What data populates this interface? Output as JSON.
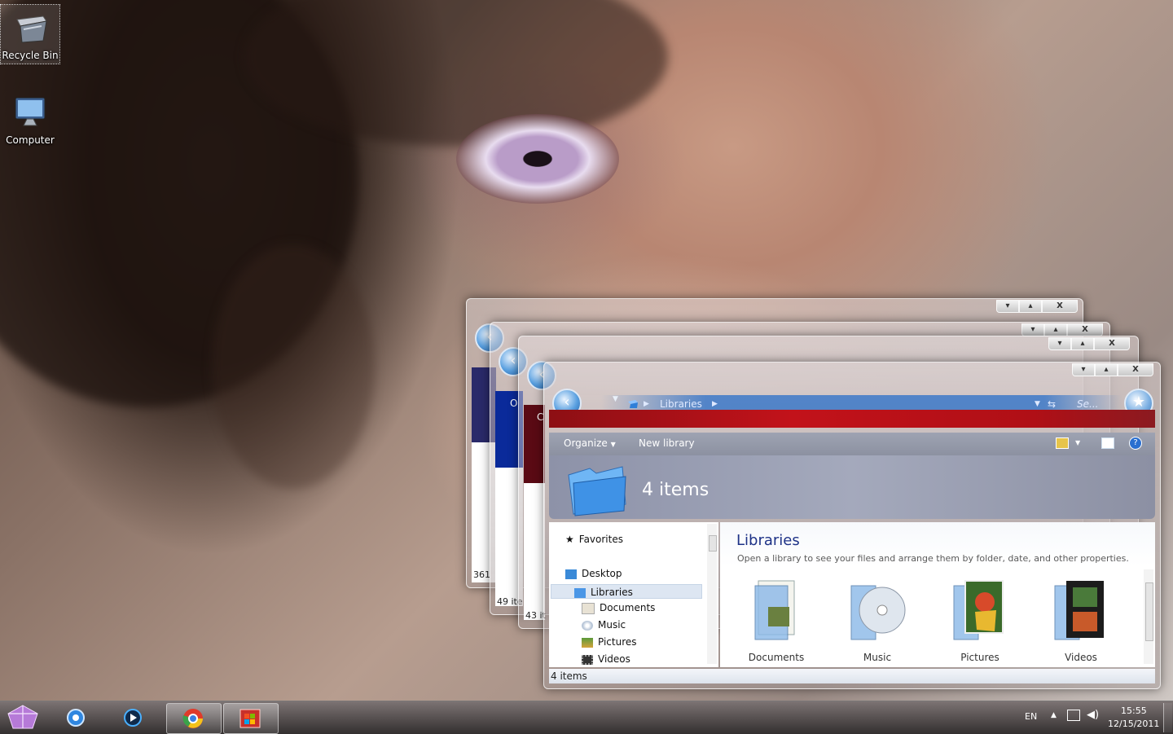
{
  "desktop": {
    "icons": [
      {
        "label": "Recycle Bin",
        "icon": "recycle-bin-icon"
      },
      {
        "label": "Computer",
        "icon": "computer-icon"
      }
    ]
  },
  "stack_windows": {
    "back1": {
      "status": "361"
    },
    "back2": {
      "partial_label": "O",
      "status": "49 ite"
    },
    "back3": {
      "partial_label": "C",
      "status": "43 it"
    }
  },
  "explorer": {
    "caption_buttons": [
      "▾",
      "▴",
      "X"
    ],
    "address": {
      "path_label": "Libraries",
      "search_placeholder": "Se..."
    },
    "toolbar": {
      "organize": "Organize",
      "new_library": "New library"
    },
    "header": {
      "item_count": "4 items"
    },
    "nav": {
      "favorites": "Favorites",
      "desktop": "Desktop",
      "libraries": "Libraries",
      "documents": "Documents",
      "music": "Music",
      "pictures": "Pictures",
      "videos": "Videos"
    },
    "content": {
      "title": "Libraries",
      "subtitle": "Open a library to see your files and arrange them by folder, date, and other properties.",
      "libraries": [
        "Documents",
        "Music",
        "Pictures",
        "Videos"
      ]
    },
    "status": "4 items"
  },
  "taskbar": {
    "language": "EN",
    "time": "15:55",
    "date": "12/15/2011",
    "apps": [
      "start-orb-icon",
      "ie-icon",
      "media-player-icon",
      "chrome-icon",
      "windows-explorer-icon"
    ]
  }
}
